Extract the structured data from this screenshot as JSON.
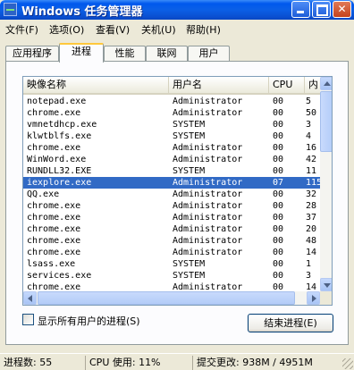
{
  "window": {
    "title": "Windows 任务管理器"
  },
  "menu": [
    "文件(F)",
    "选项(O)",
    "查看(V)",
    "关机(U)",
    "帮助(H)"
  ],
  "tabs": [
    "应用程序",
    "进程",
    "性能",
    "联网",
    "用户"
  ],
  "active_tab_index": 1,
  "columns": {
    "name": "映像名称",
    "user": "用户名",
    "cpu": "CPU",
    "mem": "内"
  },
  "processes": [
    {
      "name": "notepad.exe",
      "user": "Administrator",
      "cpu": "00",
      "mem": "5"
    },
    {
      "name": "chrome.exe",
      "user": "Administrator",
      "cpu": "00",
      "mem": "50"
    },
    {
      "name": "vmnetdhcp.exe",
      "user": "SYSTEM",
      "cpu": "00",
      "mem": "3"
    },
    {
      "name": "klwtblfs.exe",
      "user": "SYSTEM",
      "cpu": "00",
      "mem": "4"
    },
    {
      "name": "chrome.exe",
      "user": "Administrator",
      "cpu": "00",
      "mem": "16"
    },
    {
      "name": "WinWord.exe",
      "user": "Administrator",
      "cpu": "00",
      "mem": "42"
    },
    {
      "name": "RUNDLL32.EXE",
      "user": "SYSTEM",
      "cpu": "00",
      "mem": "11"
    },
    {
      "name": "iexplore.exe",
      "user": "Administrator",
      "cpu": "07",
      "mem": "115"
    },
    {
      "name": "QQ.exe",
      "user": "Administrator",
      "cpu": "00",
      "mem": "32"
    },
    {
      "name": "chrome.exe",
      "user": "Administrator",
      "cpu": "00",
      "mem": "28"
    },
    {
      "name": "chrome.exe",
      "user": "Administrator",
      "cpu": "00",
      "mem": "37"
    },
    {
      "name": "chrome.exe",
      "user": "Administrator",
      "cpu": "00",
      "mem": "20"
    },
    {
      "name": "chrome.exe",
      "user": "Administrator",
      "cpu": "00",
      "mem": "48"
    },
    {
      "name": "chrome.exe",
      "user": "Administrator",
      "cpu": "00",
      "mem": "14"
    },
    {
      "name": "lsass.exe",
      "user": "SYSTEM",
      "cpu": "00",
      "mem": "1"
    },
    {
      "name": "services.exe",
      "user": "SYSTEM",
      "cpu": "00",
      "mem": "3"
    },
    {
      "name": "chrome.exe",
      "user": "Administrator",
      "cpu": "00",
      "mem": "14"
    }
  ],
  "selected_index": 7,
  "show_all_users": {
    "label": "显示所有用户的进程(S)",
    "checked": false
  },
  "end_process_label": "结束进程(E)",
  "status": {
    "processes": "进程数: 55",
    "cpu": "CPU 使用: 11%",
    "commit": "提交更改: 938M / 4951M"
  },
  "colors": {
    "titlebar": "#0A4FD1",
    "selection": "#316AC5",
    "face": "#ECE9D8",
    "active_tab_accent": "#FFC83C"
  }
}
